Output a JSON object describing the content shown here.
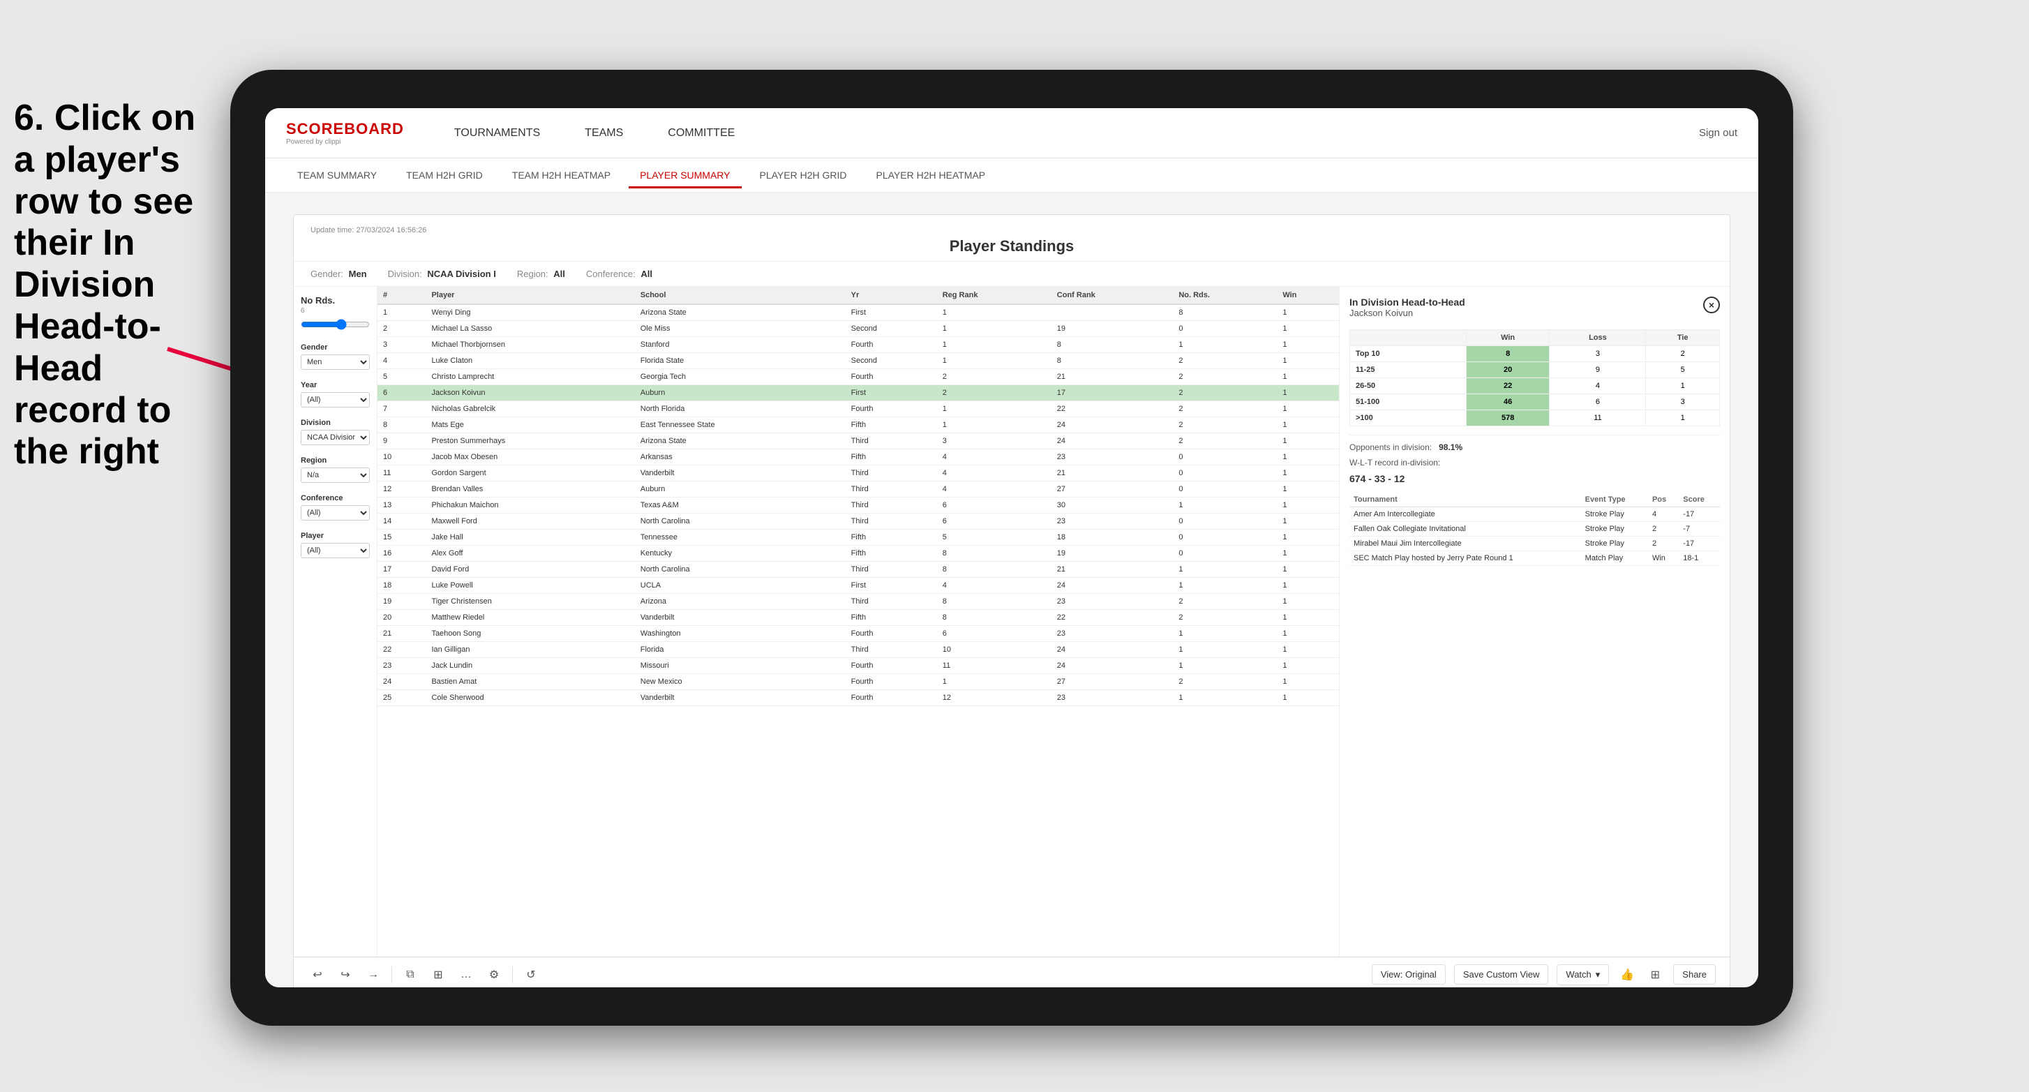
{
  "instruction": {
    "text": "6. Click on a player's row to see their In Division Head-to-Head record to the right"
  },
  "nav": {
    "logo_main": "SCOREBOARD",
    "logo_sub": "Powered by clippi",
    "items": [
      "TOURNAMENTS",
      "TEAMS",
      "COMMITTEE"
    ],
    "sign_out": "Sign out"
  },
  "sub_nav": {
    "items": [
      "TEAM SUMMARY",
      "TEAM H2H GRID",
      "TEAM H2H HEATMAP",
      "PLAYER SUMMARY",
      "PLAYER H2H GRID",
      "PLAYER H2H HEATMAP"
    ],
    "active": "PLAYER SUMMARY"
  },
  "dashboard": {
    "update_time_label": "Update time:",
    "update_time": "27/03/2024 16:56:26",
    "title": "Player Standings",
    "filters": {
      "gender_label": "Gender:",
      "gender_value": "Men",
      "division_label": "Division:",
      "division_value": "NCAA Division I",
      "region_label": "Region:",
      "region_value": "All",
      "conference_label": "Conference:",
      "conference_value": "All"
    },
    "left_panel": {
      "rounds_label": "No Rds.",
      "rounds_value": "6",
      "rounds_sub": "6",
      "gender_label": "Gender",
      "gender_value": "Men",
      "year_label": "Year",
      "year_value": "(All)",
      "division_label": "Division",
      "division_value": "NCAA Division I",
      "region_label": "Region",
      "region_value": "N/a",
      "conference_label": "Conference",
      "conference_value": "(All)",
      "player_label": "Player",
      "player_value": "(All)"
    },
    "table": {
      "headers": [
        "#",
        "Player",
        "School",
        "Yr",
        "Reg Rank",
        "Conf Rank",
        "No. Rds.",
        "Win"
      ],
      "rows": [
        {
          "num": 1,
          "player": "Wenyi Ding",
          "school": "Arizona State",
          "yr": "First",
          "reg": 1,
          "conf": "",
          "rds": 8,
          "win": 1,
          "selected": false
        },
        {
          "num": 2,
          "player": "Michael La Sasso",
          "school": "Ole Miss",
          "yr": "Second",
          "reg": 1,
          "conf": 19,
          "rds": 0,
          "win": 1,
          "selected": false
        },
        {
          "num": 3,
          "player": "Michael Thorbjornsen",
          "school": "Stanford",
          "yr": "Fourth",
          "reg": 1,
          "conf": 8,
          "rds": 1,
          "win": 1,
          "selected": false
        },
        {
          "num": 4,
          "player": "Luke Claton",
          "school": "Florida State",
          "yr": "Second",
          "reg": 1,
          "conf": 8,
          "rds": 2,
          "win": 1,
          "selected": false
        },
        {
          "num": 5,
          "player": "Christo Lamprecht",
          "school": "Georgia Tech",
          "yr": "Fourth",
          "reg": 2,
          "conf": 21,
          "rds": 2,
          "win": 1,
          "selected": false
        },
        {
          "num": 6,
          "player": "Jackson Koivun",
          "school": "Auburn",
          "yr": "First",
          "reg": 2,
          "conf": 17,
          "rds": 2,
          "win": 1,
          "selected": true
        },
        {
          "num": 7,
          "player": "Nicholas Gabrelcik",
          "school": "North Florida",
          "yr": "Fourth",
          "reg": 1,
          "conf": 22,
          "rds": 2,
          "win": 1,
          "selected": false
        },
        {
          "num": 8,
          "player": "Mats Ege",
          "school": "East Tennessee State",
          "yr": "Fifth",
          "reg": 1,
          "conf": 24,
          "rds": 2,
          "win": 1,
          "selected": false
        },
        {
          "num": 9,
          "player": "Preston Summerhays",
          "school": "Arizona State",
          "yr": "Third",
          "reg": 3,
          "conf": 24,
          "rds": 2,
          "win": 1,
          "selected": false
        },
        {
          "num": 10,
          "player": "Jacob Max Obesen",
          "school": "Arkansas",
          "yr": "Fifth",
          "reg": 4,
          "conf": 23,
          "rds": 0,
          "win": 1,
          "selected": false
        },
        {
          "num": 11,
          "player": "Gordon Sargent",
          "school": "Vanderbilt",
          "yr": "Third",
          "reg": 4,
          "conf": 21,
          "rds": 0,
          "win": 1,
          "selected": false
        },
        {
          "num": 12,
          "player": "Brendan Valles",
          "school": "Auburn",
          "yr": "Third",
          "reg": 4,
          "conf": 27,
          "rds": 0,
          "win": 1,
          "selected": false
        },
        {
          "num": 13,
          "player": "Phichakun Maichon",
          "school": "Texas A&M",
          "yr": "Third",
          "reg": 6,
          "conf": 30,
          "rds": 1,
          "win": 1,
          "selected": false
        },
        {
          "num": 14,
          "player": "Maxwell Ford",
          "school": "North Carolina",
          "yr": "Third",
          "reg": 6,
          "conf": 23,
          "rds": 0,
          "win": 1,
          "selected": false
        },
        {
          "num": 15,
          "player": "Jake Hall",
          "school": "Tennessee",
          "yr": "Fifth",
          "reg": 5,
          "conf": 18,
          "rds": 0,
          "win": 1,
          "selected": false
        },
        {
          "num": 16,
          "player": "Alex Goff",
          "school": "Kentucky",
          "yr": "Fifth",
          "reg": 8,
          "conf": 19,
          "rds": 0,
          "win": 1,
          "selected": false
        },
        {
          "num": 17,
          "player": "David Ford",
          "school": "North Carolina",
          "yr": "Third",
          "reg": 8,
          "conf": 21,
          "rds": 1,
          "win": 1,
          "selected": false
        },
        {
          "num": 18,
          "player": "Luke Powell",
          "school": "UCLA",
          "yr": "First",
          "reg": 4,
          "conf": 24,
          "rds": 1,
          "win": 1,
          "selected": false
        },
        {
          "num": 19,
          "player": "Tiger Christensen",
          "school": "Arizona",
          "yr": "Third",
          "reg": 8,
          "conf": 23,
          "rds": 2,
          "win": 1,
          "selected": false
        },
        {
          "num": 20,
          "player": "Matthew Riedel",
          "school": "Vanderbilt",
          "yr": "Fifth",
          "reg": 8,
          "conf": 22,
          "rds": 2,
          "win": 1,
          "selected": false
        },
        {
          "num": 21,
          "player": "Taehoon Song",
          "school": "Washington",
          "yr": "Fourth",
          "reg": 6,
          "conf": 23,
          "rds": 1,
          "win": 1,
          "selected": false
        },
        {
          "num": 22,
          "player": "Ian Gilligan",
          "school": "Florida",
          "yr": "Third",
          "reg": 10,
          "conf": 24,
          "rds": 1,
          "win": 1,
          "selected": false
        },
        {
          "num": 23,
          "player": "Jack Lundin",
          "school": "Missouri",
          "yr": "Fourth",
          "reg": 11,
          "conf": 24,
          "rds": 1,
          "win": 1,
          "selected": false
        },
        {
          "num": 24,
          "player": "Bastien Amat",
          "school": "New Mexico",
          "yr": "Fourth",
          "reg": 1,
          "conf": 27,
          "rds": 2,
          "win": 1,
          "selected": false
        },
        {
          "num": 25,
          "player": "Cole Sherwood",
          "school": "Vanderbilt",
          "yr": "Fourth",
          "reg": 12,
          "conf": 23,
          "rds": 1,
          "win": 1,
          "selected": false
        }
      ]
    },
    "h2h": {
      "title": "In Division Head-to-Head",
      "player": "Jackson Koivun",
      "close_label": "×",
      "grid": {
        "headers": [
          "",
          "Win",
          "Loss",
          "Tie"
        ],
        "rows": [
          {
            "rank": "Top 10",
            "win": 8,
            "loss": 3,
            "tie": 2,
            "win_highlight": true
          },
          {
            "rank": "11-25",
            "win": 20,
            "loss": 9,
            "tie": 5,
            "win_highlight": true
          },
          {
            "rank": "26-50",
            "win": 22,
            "loss": 4,
            "tie": 1,
            "win_highlight": true
          },
          {
            "rank": "51-100",
            "win": 46,
            "loss": 6,
            "tie": 3,
            "win_highlight": true
          },
          {
            "rank": ">100",
            "win": 578,
            "loss": 11,
            "tie": 1,
            "win_highlight": true
          }
        ]
      },
      "opponents_pct_label": "Opponents in division:",
      "opponents_pct": "98.1%",
      "wlt_label": "W-L-T record in-division:",
      "wlt": "674 - 33 - 12",
      "tournaments": {
        "headers": [
          "Tournament",
          "Event Type",
          "Pos",
          "Score"
        ],
        "rows": [
          {
            "tournament": "Amer Am Intercollegiate",
            "event_type": "Stroke Play",
            "pos": 4,
            "score": -17
          },
          {
            "tournament": "Fallen Oak Collegiate Invitational",
            "event_type": "Stroke Play",
            "pos": 2,
            "score": -7
          },
          {
            "tournament": "Mirabel Maui Jim Intercollegiate",
            "event_type": "Stroke Play",
            "pos": 2,
            "score": -17
          },
          {
            "tournament": "SEC Match Play hosted by Jerry Pate Round 1",
            "event_type": "Match Play",
            "pos": "Win",
            "score": "18-1"
          }
        ]
      }
    }
  },
  "toolbar": {
    "undo": "↩",
    "redo": "↪",
    "forward": "→",
    "copy": "⧉",
    "paste": "⊞",
    "more": "…",
    "settings": "⚙",
    "view_original": "View: Original",
    "save_custom": "Save Custom View",
    "watch": "Watch",
    "share": "Share"
  }
}
